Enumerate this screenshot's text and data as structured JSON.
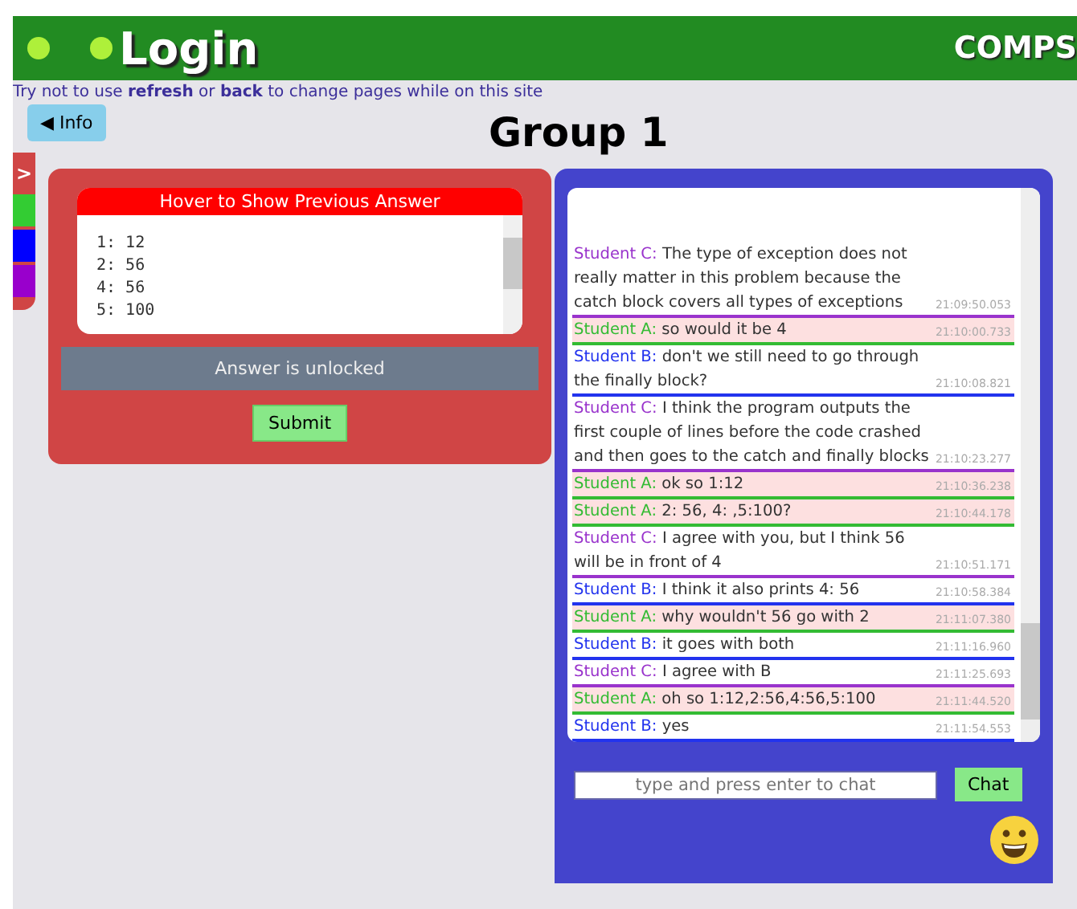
{
  "header": {
    "title": "Login",
    "brand": "COMPS"
  },
  "notice": "Try not to use **refresh** or **back** to change pages while on this site",
  "info_button": "Info",
  "info_arrow": "◀",
  "page_title": "Group 1",
  "side_tabs": {
    "toggle": ">",
    "bands": [
      {
        "color": "#33cc33"
      },
      {
        "color": "#0000ff"
      },
      {
        "color": "#9900cc"
      }
    ]
  },
  "answer_panel": {
    "heading": "Hover to Show Previous Answer",
    "answer_lines": [
      "1: 12",
      "2: 56",
      "4: 56",
      "5: 100"
    ],
    "status": "Answer is unlocked",
    "submit": "Submit"
  },
  "chat": {
    "messages": [
      {
        "sender": "Student C:",
        "text": "The type of exception does not really matter in this problem because the catch block covers all types of exceptions",
        "time": "21:09:50.053",
        "color": "#9933cc",
        "highlighted": false
      },
      {
        "sender": "Student A:",
        "text": "so would it be 4",
        "time": "21:10:00.733",
        "color": "#33bb33",
        "highlighted": true
      },
      {
        "sender": "Student B:",
        "text": "don't we still need to go through the finally block?",
        "time": "21:10:08.821",
        "color": "#2233ee",
        "highlighted": false
      },
      {
        "sender": "Student C:",
        "text": "I think the program outputs the first couple of lines before the code crashed and then goes to the catch and finally blocks",
        "time": "21:10:23.277",
        "color": "#9933cc",
        "highlighted": false
      },
      {
        "sender": "Student A:",
        "text": "ok so 1:12",
        "time": "21:10:36.238",
        "color": "#33bb33",
        "highlighted": true
      },
      {
        "sender": "Student A:",
        "text": "2: 56, 4: ,5:100?",
        "time": "21:10:44.178",
        "color": "#33bb33",
        "highlighted": true
      },
      {
        "sender": "Student C:",
        "text": "I agree with you, but I think 56 will be in front of 4",
        "time": "21:10:51.171",
        "color": "#9933cc",
        "highlighted": false
      },
      {
        "sender": "Student B:",
        "text": "I think it also prints 4: 56",
        "time": "21:10:58.384",
        "color": "#2233ee",
        "highlighted": false
      },
      {
        "sender": "Student A:",
        "text": "why wouldn't 56 go with 2",
        "time": "21:11:07.380",
        "color": "#33bb33",
        "highlighted": true
      },
      {
        "sender": "Student B:",
        "text": "it goes with both",
        "time": "21:11:16.960",
        "color": "#2233ee",
        "highlighted": false
      },
      {
        "sender": "Student C:",
        "text": "I agree with B",
        "time": "21:11:25.693",
        "color": "#9933cc",
        "highlighted": false
      },
      {
        "sender": "Student A:",
        "text": "oh so 1:12,2:56,4:56,5:100",
        "time": "21:11:44.520",
        "color": "#33bb33",
        "highlighted": true
      },
      {
        "sender": "Student B:",
        "text": "yes",
        "time": "21:11:54.553",
        "color": "#2233ee",
        "highlighted": false
      }
    ],
    "input": {
      "placeholder": "type and press enter to chat"
    },
    "send": "Chat"
  }
}
